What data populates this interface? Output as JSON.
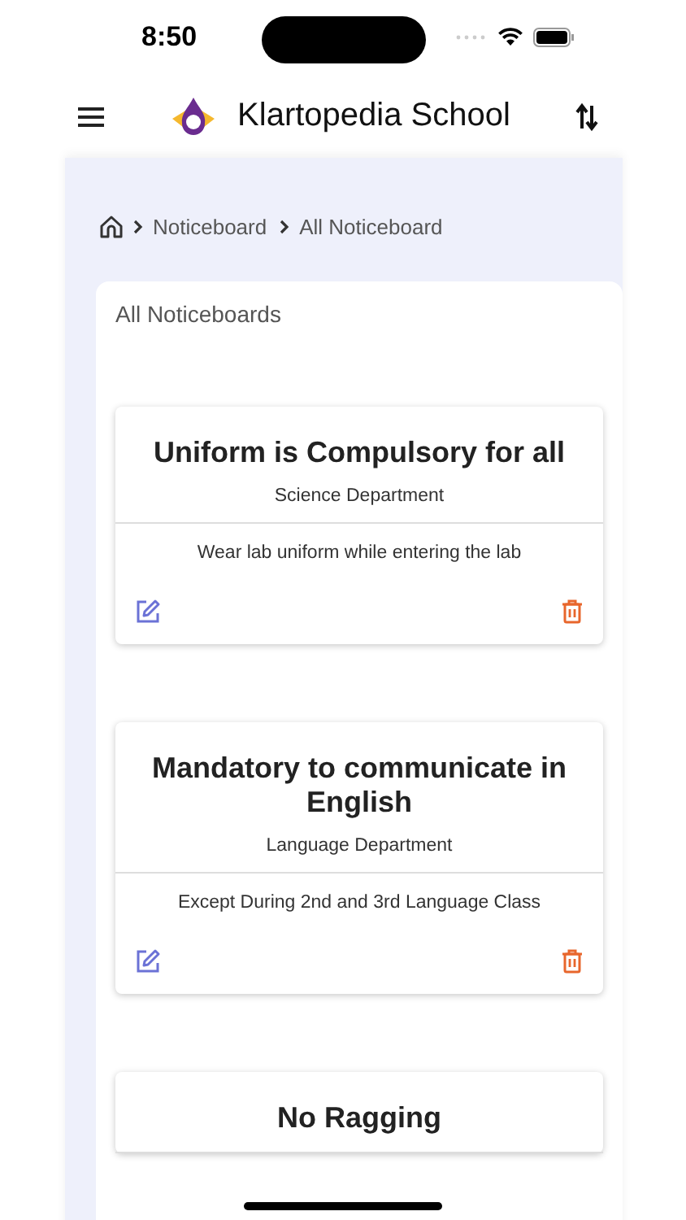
{
  "status_bar": {
    "time": "8:50"
  },
  "header": {
    "title": "Klartopedia School"
  },
  "breadcrumb": [
    "Noticeboard",
    "All Noticeboard"
  ],
  "panel": {
    "title": "All Noticeboards"
  },
  "notices": [
    {
      "title": "Uniform is Compulsory for all",
      "department": "Science Department",
      "body": "Wear lab uniform while entering the lab"
    },
    {
      "title": "Mandatory to communicate in English",
      "department": "Language Department",
      "body": "Except During 2nd and 3rd Language Class"
    },
    {
      "title": "No Ragging"
    }
  ]
}
